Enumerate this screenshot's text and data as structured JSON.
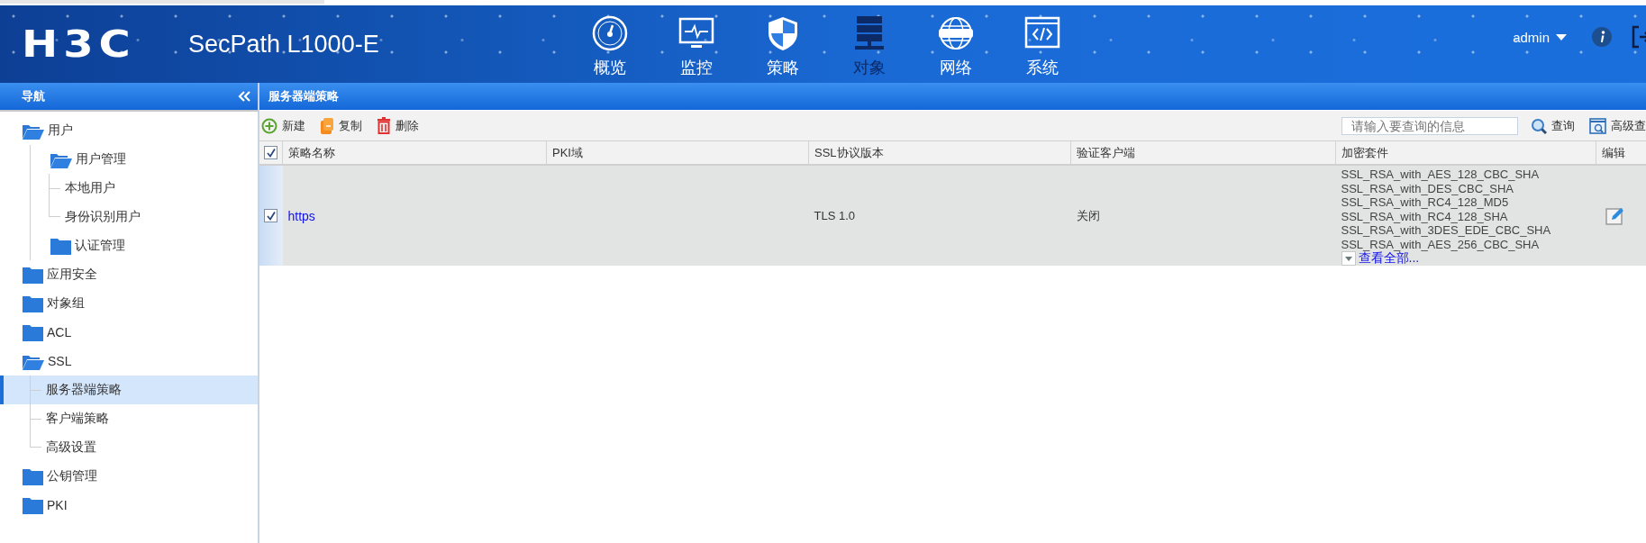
{
  "header": {
    "logo": "H3C",
    "product": "SecPath L1000-E",
    "user": "admin",
    "menu": [
      {
        "label": "概览",
        "kind": "gauge",
        "selected": false
      },
      {
        "label": "监控",
        "kind": "monitor",
        "selected": false
      },
      {
        "label": "策略",
        "kind": "shield",
        "selected": false
      },
      {
        "label": "对象",
        "kind": "server",
        "selected": true
      },
      {
        "label": "网络",
        "kind": "globe",
        "selected": false
      },
      {
        "label": "系统",
        "kind": "code",
        "selected": false
      }
    ]
  },
  "sidebar": {
    "title": "导航",
    "items": [
      {
        "label": "用户",
        "kind": "folder",
        "expanded": true,
        "selected": false,
        "children": [
          {
            "label": "用户管理",
            "kind": "folder",
            "expanded": true,
            "selected": false,
            "children": [
              {
                "label": "本地用户",
                "kind": "leaf",
                "selected": false
              },
              {
                "label": "身份识别用户",
                "kind": "leaf",
                "selected": false
              }
            ]
          },
          {
            "label": "认证管理",
            "kind": "folder",
            "expanded": false,
            "selected": false
          }
        ]
      },
      {
        "label": "应用安全",
        "kind": "folder",
        "expanded": false,
        "selected": false
      },
      {
        "label": "对象组",
        "kind": "folder",
        "expanded": false,
        "selected": false
      },
      {
        "label": "ACL",
        "kind": "folder",
        "expanded": false,
        "selected": false
      },
      {
        "label": "SSL",
        "kind": "folder",
        "expanded": true,
        "selected": false,
        "children": [
          {
            "label": "服务器端策略",
            "kind": "leaf",
            "selected": true
          },
          {
            "label": "客户端策略",
            "kind": "leaf",
            "selected": false
          },
          {
            "label": "高级设置",
            "kind": "leaf",
            "selected": false
          }
        ]
      },
      {
        "label": "公钥管理",
        "kind": "folder",
        "expanded": false,
        "selected": false
      },
      {
        "label": "PKI",
        "kind": "folder",
        "expanded": false,
        "selected": false
      }
    ]
  },
  "panel": {
    "title": "服务器端策略",
    "toolbar": [
      {
        "label": "新建",
        "kind": "add"
      },
      {
        "label": "复制",
        "kind": "copy"
      },
      {
        "label": "删除",
        "kind": "delete"
      }
    ],
    "search": {
      "placeholder": "请输入要查询的信息",
      "button": "查询",
      "advanced": "高级查"
    },
    "table": {
      "select_all_checked": true,
      "columns": [
        "策略名称",
        "PKI域",
        "SSL协议版本",
        "验证客户端",
        "加密套件",
        "编辑"
      ],
      "rows": [
        {
          "checked": true,
          "name": "https",
          "ssl_version": "TLS 1.0",
          "verify_client": "关闭",
          "cipher_suites": [
            "SSL_RSA_with_AES_128_CBC_SHA",
            "SSL_RSA_with_DES_CBC_SHA",
            "SSL_RSA_with_RC4_128_MD5",
            "SSL_RSA_with_RC4_128_SHA",
            "SSL_RSA_with_3DES_EDE_CBC_SHA",
            "SSL_RSA_with_AES_256_CBC_SHA"
          ],
          "view_all": "查看全部..."
        }
      ]
    }
  }
}
